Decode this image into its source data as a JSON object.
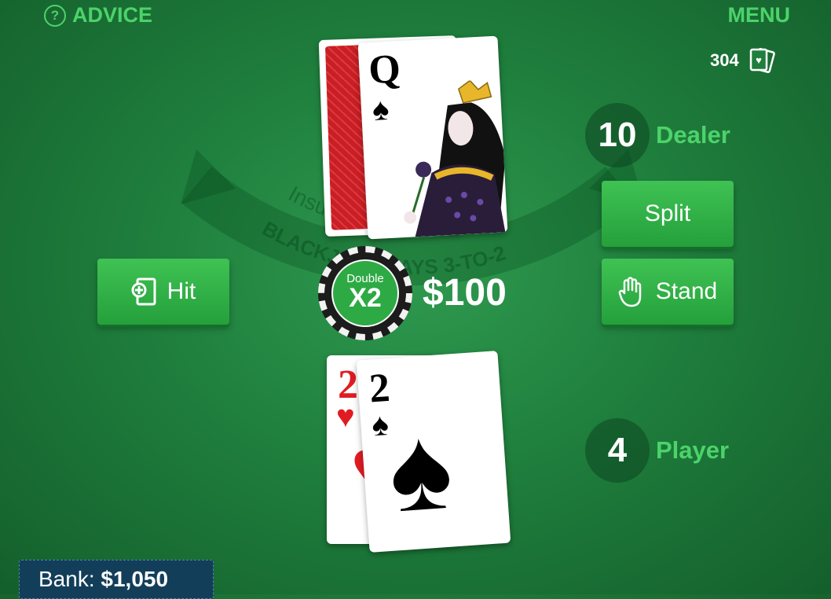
{
  "header": {
    "advice_label": "ADVICE",
    "advice_icon": "?",
    "menu_label": "MENU",
    "deck_count": "304"
  },
  "table_text": {
    "line1": "Insurance pays 2-to-1",
    "line2": "BLACKJACK PAYS 3-TO-2"
  },
  "dealer": {
    "score": "10",
    "label": "Dealer",
    "cards": [
      {
        "face": "down",
        "back_color": "#d8262b"
      },
      {
        "face": "up",
        "rank": "Q",
        "suit": "♠",
        "suit_color": "#000000"
      }
    ]
  },
  "player": {
    "score": "4",
    "label": "Player",
    "cards": [
      {
        "rank": "2",
        "suit": "♥",
        "suit_color": "#e11b22"
      },
      {
        "rank": "2",
        "suit": "♠",
        "suit_color": "#000000"
      }
    ]
  },
  "buttons": {
    "hit": "Hit",
    "split": "Split",
    "stand": "Stand"
  },
  "chip": {
    "top_text": "Double",
    "main_text": "X2"
  },
  "bet": "$100",
  "bank": {
    "label": "Bank:",
    "value": "$1,050"
  },
  "colors": {
    "accent_green": "#4cd36a",
    "button_green": "#2eaa44",
    "felt": "#1f7f3d",
    "bank_bg": "#123e5a"
  }
}
